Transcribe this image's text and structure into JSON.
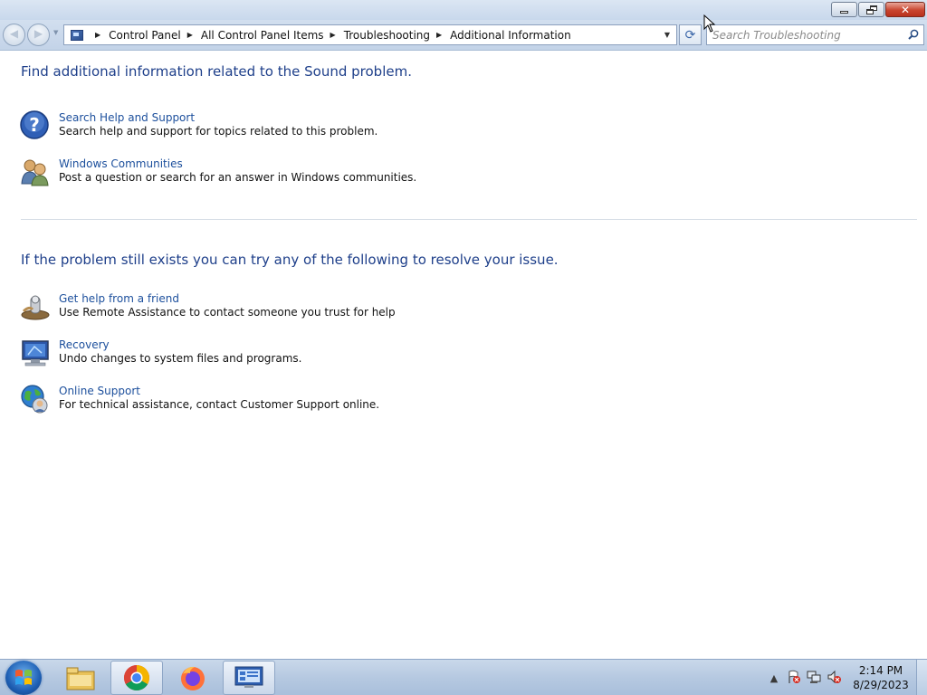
{
  "window": {
    "buttons": {
      "minimize": "minimize",
      "maximize": "restore",
      "close": "close"
    }
  },
  "nav": {
    "back_glyph": "◀",
    "forward_glyph": "▶",
    "recent_glyph": "▼",
    "breadcrumbs": [
      "Control Panel",
      "All Control Panel Items",
      "Troubleshooting",
      "Additional Information"
    ],
    "separator": "▶",
    "dropdown_glyph": "▼",
    "refresh_glyph": "⟳",
    "search_placeholder": "Search Troubleshooting"
  },
  "main": {
    "heading1": "Find additional information related to the Sound problem.",
    "section1": [
      {
        "icon": "help-question-icon",
        "link": "Search Help and Support",
        "desc": "Search help and support for topics related to this problem."
      },
      {
        "icon": "communities-people-icon",
        "link": "Windows Communities",
        "desc": "Post a question or search for an answer in Windows communities."
      }
    ],
    "heading2": "If the problem still exists you can try any of the following to resolve your issue.",
    "section2": [
      {
        "icon": "remote-assistance-icon",
        "link": "Get help from a friend",
        "desc": "Use Remote Assistance to contact someone you trust for help"
      },
      {
        "icon": "recovery-computer-icon",
        "link": "Recovery",
        "desc": "Undo changes to system files and programs."
      },
      {
        "icon": "online-support-globe-icon",
        "link": "Online Support",
        "desc": "For technical assistance, contact Customer Support online."
      }
    ]
  },
  "taskbar": {
    "apps": [
      "file-explorer-icon",
      "chrome-icon",
      "firefox-icon",
      "control-panel-icon"
    ],
    "tray": {
      "show_hidden_glyph": "▲",
      "time": "2:14 PM",
      "date": "8/29/2023"
    }
  },
  "colors": {
    "heading": "#1e3f8a",
    "link": "#1c4f9c",
    "taskbar": "#b6c9e1"
  }
}
